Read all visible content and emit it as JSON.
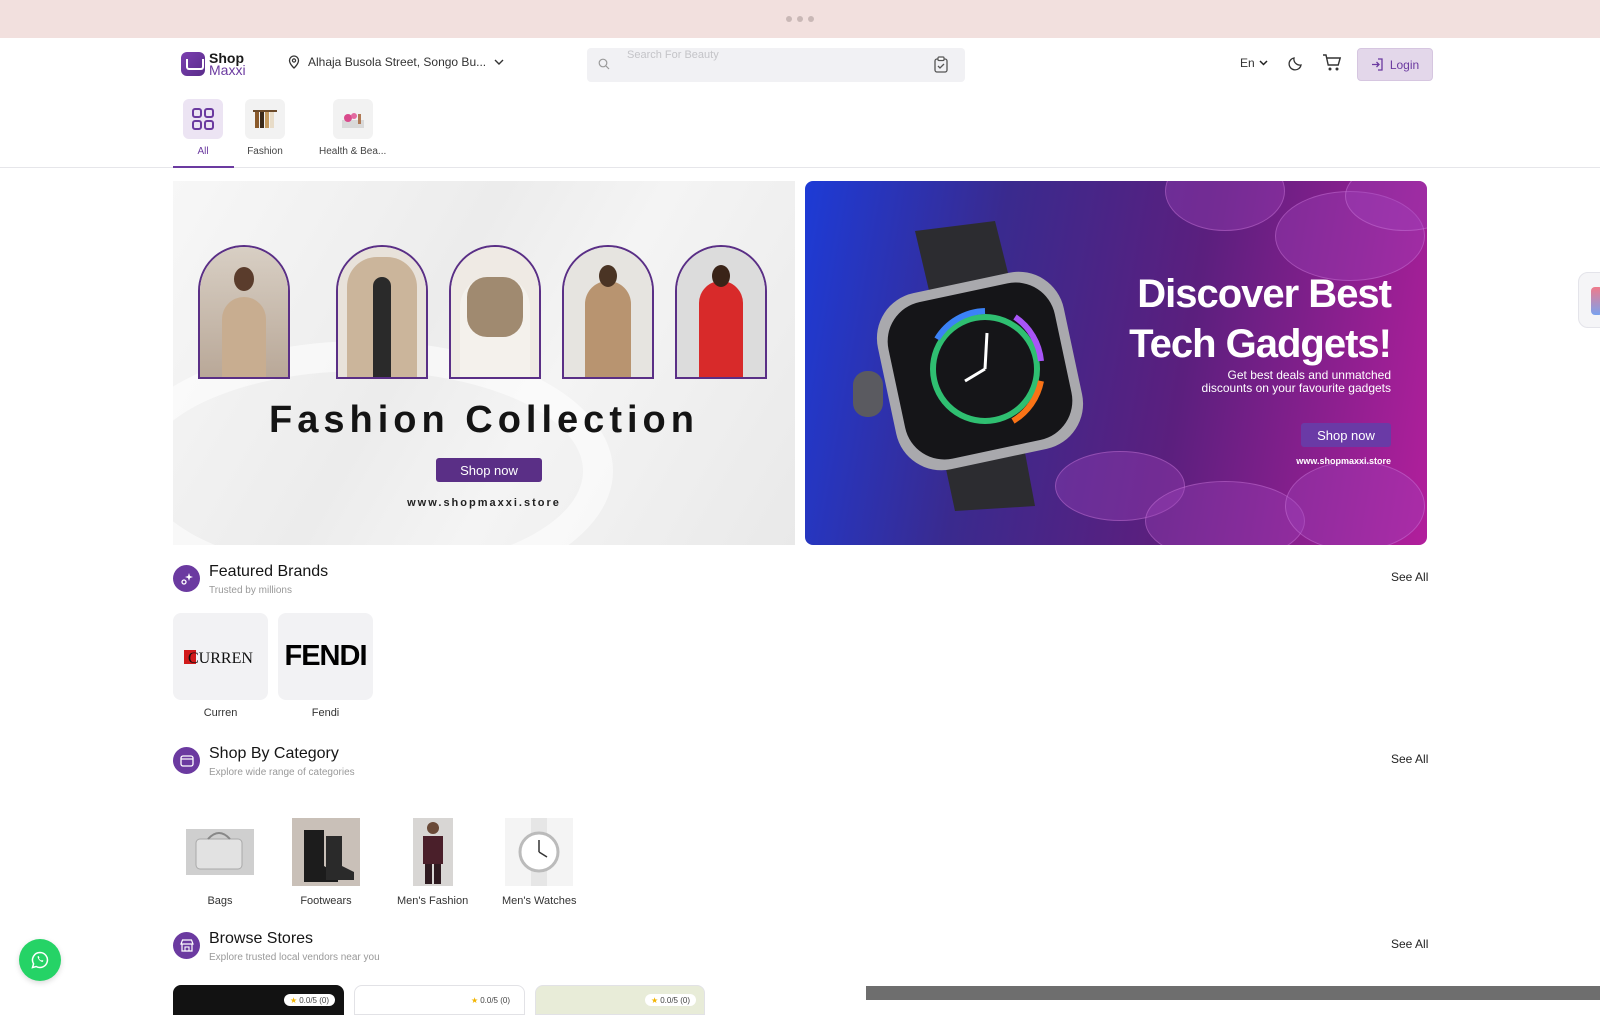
{
  "topbar": {
    "handle": "•••"
  },
  "header": {
    "logo": {
      "line1": "Shop",
      "line2": "Maxxi"
    },
    "location": "Alhaja Busola Street, Songo Bu...",
    "search": {
      "placeholder": "Search For Beauty"
    },
    "language": "En",
    "login_label": "Login"
  },
  "categories": [
    {
      "label": "All",
      "active": true
    },
    {
      "label": "Fashion",
      "active": false
    },
    {
      "label": "Health & Bea...",
      "active": false
    }
  ],
  "banners": {
    "fashion": {
      "title": "Fashion Collection",
      "button": "Shop now",
      "url": "www.shopmaxxi.store"
    },
    "tech": {
      "title_line1": "Discover Best",
      "title_line2": "Tech Gadgets!",
      "subtitle": "Get best deals and unmatched discounts on your favourite gadgets",
      "button": "Shop now",
      "url": "www.shopmaxxi.store"
    }
  },
  "featured_brands": {
    "title": "Featured Brands",
    "subtitle": "Trusted by millions",
    "see_all": "See All",
    "items": [
      {
        "label": "Curren",
        "logo_text": "CURREN"
      },
      {
        "label": "Fendi",
        "logo_text": "FENDI"
      }
    ]
  },
  "shop_by_category": {
    "title": "Shop By Category",
    "subtitle": "Explore wide range of categories",
    "see_all": "See All",
    "items": [
      {
        "label": "Bags"
      },
      {
        "label": "Footwears"
      },
      {
        "label": "Men's Fashion"
      },
      {
        "label": "Men's Watches"
      }
    ]
  },
  "browse_stores": {
    "title": "Browse Stores",
    "subtitle": "Explore trusted local vendors near you",
    "see_all": "See All",
    "stores": [
      {
        "rating": "0.0/5 (0)"
      },
      {
        "rating": "0.0/5 (0)"
      },
      {
        "rating": "0.0/5 (0)"
      }
    ]
  },
  "colors": {
    "brand": "#6b3aa0",
    "topbar": "#f2e0de",
    "whatsapp": "#25d366"
  }
}
